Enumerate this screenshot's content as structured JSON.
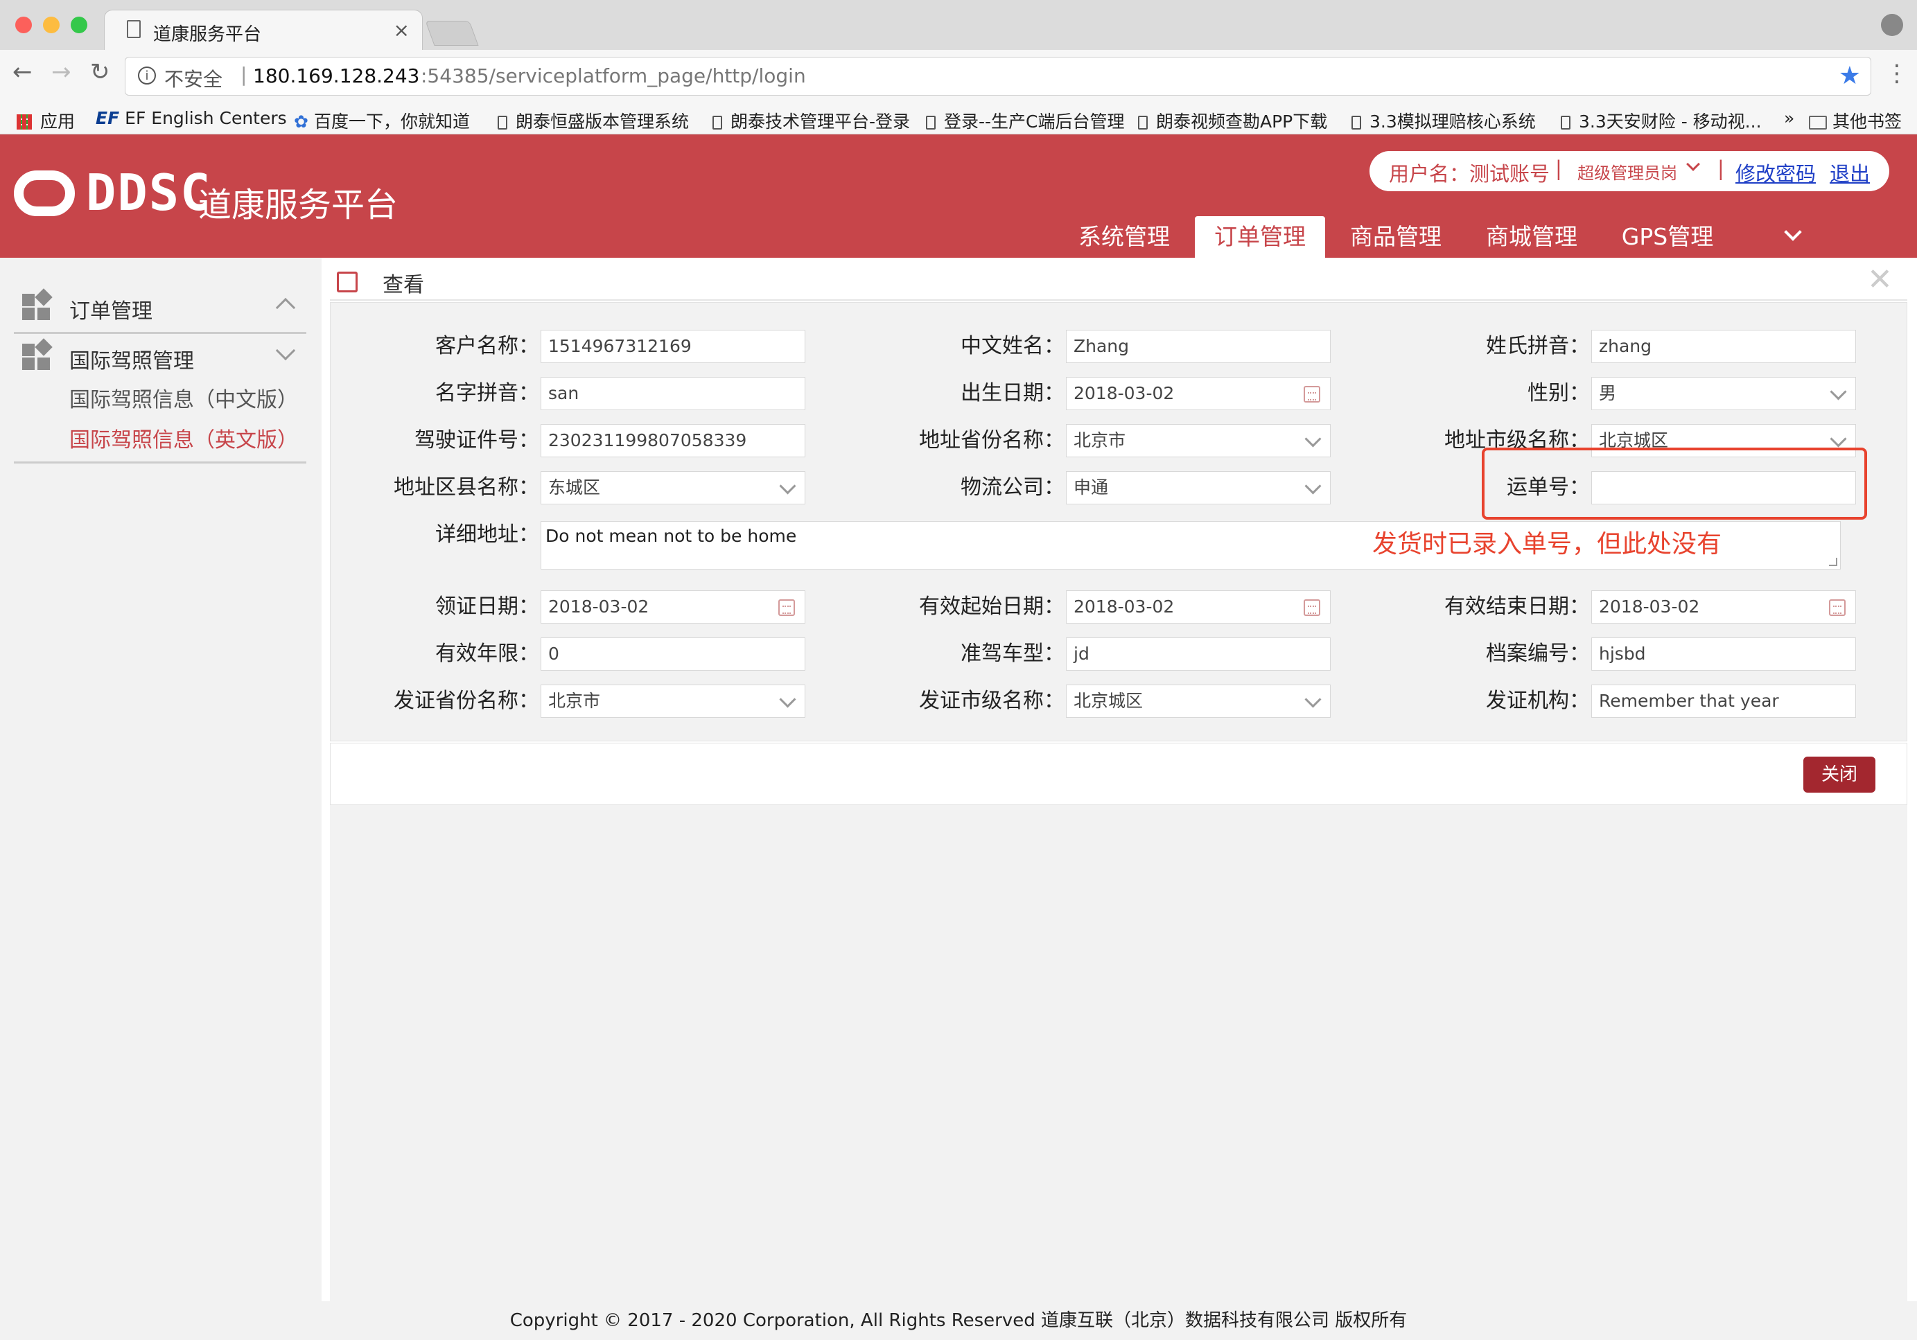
{
  "browser": {
    "tab_title": "道康服务平台",
    "url_security": "不安全",
    "url_host": "180.169.128.243",
    "url_rest": ":54385/serviceplatform_page/http/login",
    "bookmarks": [
      "应用",
      "EF English Centers",
      "百度一下，你就知道",
      "朗泰恒盛版本管理系统",
      "朗泰技术管理平台-登录",
      "登录--生产C端后台管理",
      "朗泰视频查勘APP下载",
      "3.3模拟理赔核心系统",
      "3.3天安财险 - 移动视..."
    ],
    "bookmarks_more": "»",
    "other_bookmarks": "其他书签"
  },
  "header": {
    "logo_text": "DDSC",
    "logo_subtitle": "道康服务平台",
    "username_label": "用户名：测试账号",
    "separator": "|",
    "role": "超级管理员岗",
    "change_password": "修改密码",
    "logout": "退出",
    "nav": [
      "系统管理",
      "订单管理",
      "商品管理",
      "商城管理",
      "GPS管理"
    ]
  },
  "sidebar": {
    "group1": "订单管理",
    "group2": "国际驾照管理",
    "sub_items": [
      "国际驾照信息（中文版）",
      "国际驾照信息（英文版）"
    ]
  },
  "panel": {
    "title": "查看"
  },
  "form": {
    "customer_name_label": "客户名称：",
    "customer_name": "1514967312169",
    "chinese_name_label": "中文姓名：",
    "chinese_name": "Zhang",
    "surname_pinyin_label": "姓氏拼音：",
    "surname_pinyin": "zhang",
    "name_pinyin_label": "名字拼音：",
    "name_pinyin": "san",
    "birth_date_label": "出生日期：",
    "birth_date": "2018-03-02",
    "gender_label": "性别：",
    "gender": "男",
    "license_no_label": "驾驶证件号：",
    "license_no": "230231199807058339",
    "province_label": "地址省份名称：",
    "province": "北京市",
    "city_label": "地址市级名称：",
    "city": "北京城区",
    "district_label": "地址区县名称：",
    "district": "东城区",
    "logistics_label": "物流公司：",
    "logistics": "申通",
    "tracking_label": "运单号：",
    "tracking": "",
    "address_label": "详细地址：",
    "address": "Do not mean not to be home",
    "issue_date_label": "领证日期：",
    "issue_date": "2018-03-02",
    "valid_start_label": "有效起始日期：",
    "valid_start": "2018-03-02",
    "valid_end_label": "有效结束日期：",
    "valid_end": "2018-03-02",
    "valid_years_label": "有效年限：",
    "valid_years": "0",
    "vehicle_type_label": "准驾车型：",
    "vehicle_type": "jd",
    "file_no_label": "档案编号：",
    "file_no": "hjsbd",
    "issue_province_label": "发证省份名称：",
    "issue_province": "北京市",
    "issue_city_label": "发证市级名称：",
    "issue_city": "北京城区",
    "issuer_label": "发证机构：",
    "issuer": "Remember that year"
  },
  "annotation": "发货时已录入单号，但此处没有",
  "close_button": "关闭",
  "footer": "Copyright © 2017 - 2020 Corporation, All Rights Reserved 道康互联（北京）数据科技有限公司 版权所有",
  "colors": {
    "brand": "#c7454a",
    "annotation": "#e8432e",
    "close": "#a3272f"
  }
}
